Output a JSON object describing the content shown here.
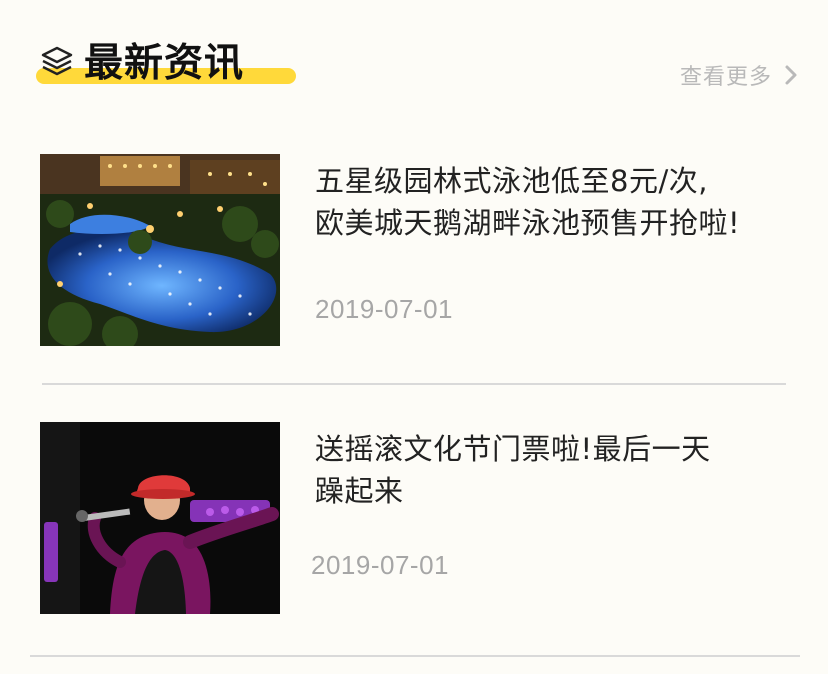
{
  "header": {
    "title": "最新资讯",
    "more_label": "查看更多",
    "accent_color": "#ffd93a"
  },
  "news": [
    {
      "title_line1": "五星级园林式泳池低至8元/次,",
      "title_line2": "欧美城天鹅湖畔泳池预售开抢啦!",
      "date": "2019-07-01",
      "image": "night-resort-pool-photo"
    },
    {
      "title_line1": "送摇滚文化节门票啦!最后一天",
      "title_line2": "躁起来",
      "date": "2019-07-01",
      "image": "rock-singer-concert-photo"
    }
  ]
}
